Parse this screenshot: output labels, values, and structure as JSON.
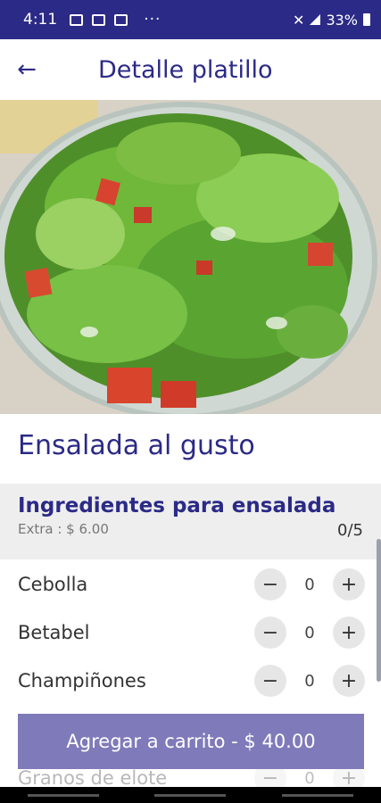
{
  "status_bar": {
    "time": "4:11",
    "battery": "33%"
  },
  "app_bar": {
    "title": "Detalle platillo"
  },
  "dish": {
    "name": "Ensalada al gusto"
  },
  "section": {
    "title": "Ingredientes para ensalada",
    "extra": "Extra : $ 6.00",
    "count": "0/5"
  },
  "ingredients": [
    {
      "label": "Cebolla",
      "qty": "0"
    },
    {
      "label": "Betabel",
      "qty": "0"
    },
    {
      "label": "Champiñones",
      "qty": "0"
    },
    {
      "label": "Granos de elote",
      "qty": "0"
    }
  ],
  "stepper": {
    "minus": "−",
    "plus": "+"
  },
  "cart_button": {
    "label": "Agregar a carrito - $ 40.00"
  },
  "colors": {
    "primary": "#2b2a86",
    "button": "#7f7ab9"
  }
}
